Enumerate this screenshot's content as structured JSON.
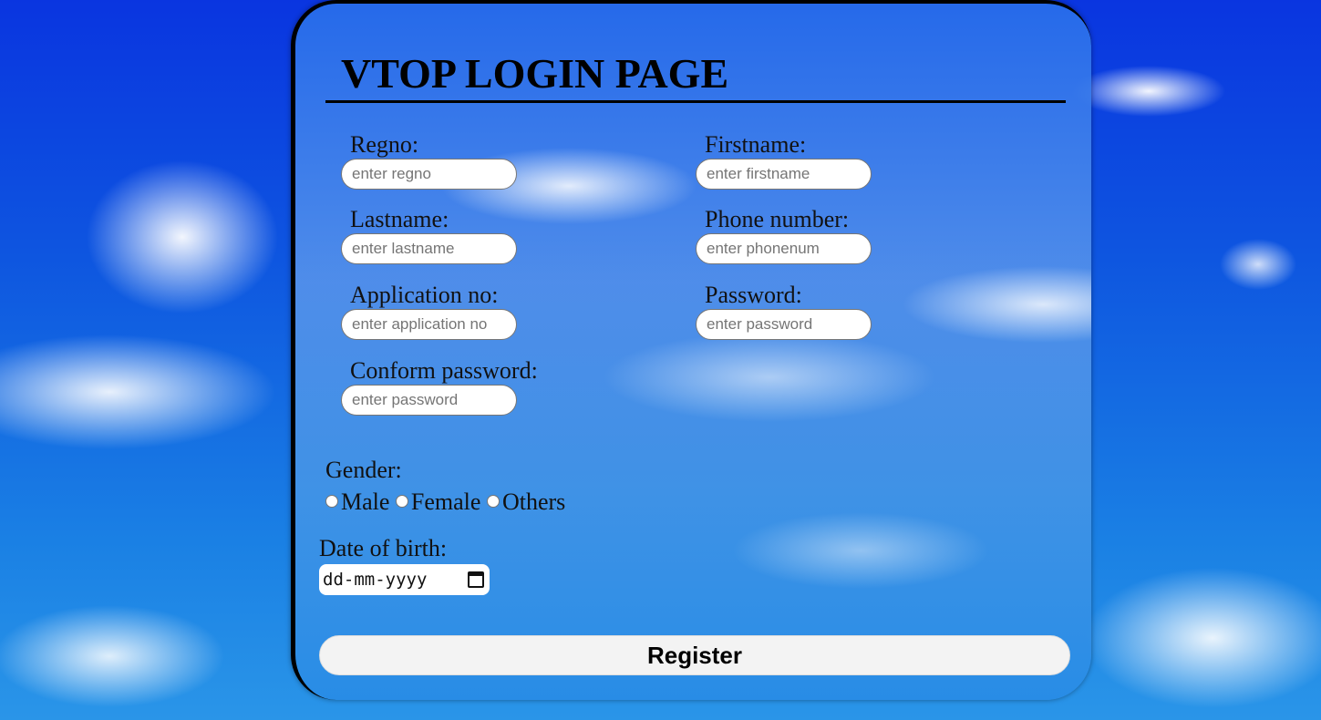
{
  "title": "VTOP LOGIN PAGE",
  "fields": {
    "regno": {
      "label": "Regno:",
      "placeholder": "enter regno"
    },
    "firstname": {
      "label": "Firstname:",
      "placeholder": "enter firstname"
    },
    "lastname": {
      "label": "Lastname:",
      "placeholder": "enter lastname"
    },
    "phone": {
      "label": "Phone number:",
      "placeholder": "enter phonenum"
    },
    "application": {
      "label": "Application no:",
      "placeholder": "enter application no"
    },
    "password": {
      "label": "Password:",
      "placeholder": "enter password"
    },
    "confirm_password": {
      "label": "Conform password:",
      "placeholder": "enter password"
    }
  },
  "gender": {
    "label": "Gender:",
    "options": [
      "Male",
      "Female",
      "Others"
    ]
  },
  "dob": {
    "label": "Date of birth:",
    "placeholder": "dd-mm-yyyy",
    "icon": "calendar-icon"
  },
  "register_label": "Register"
}
